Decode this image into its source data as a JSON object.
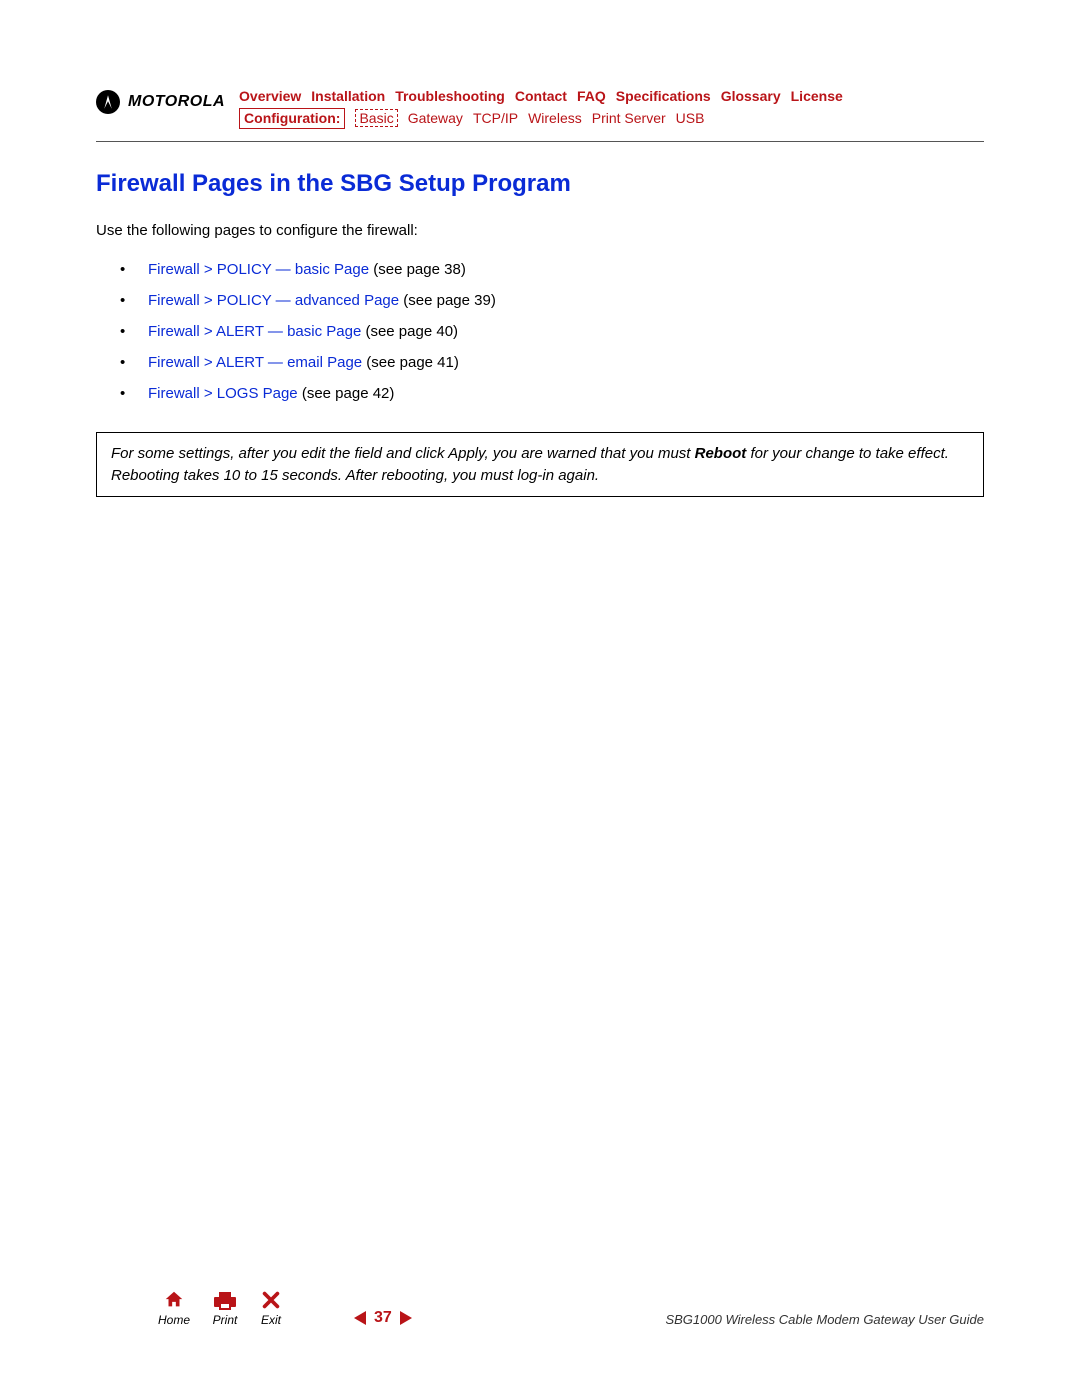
{
  "brand": {
    "word": "MOTOROLA"
  },
  "nav_top": [
    "Overview",
    "Installation",
    "Troubleshooting",
    "Contact",
    "FAQ",
    "Specifications",
    "Glossary",
    "License"
  ],
  "nav_sub": {
    "label": "Configuration:",
    "items": [
      "Basic",
      "Gateway",
      "TCP/IP",
      "Wireless",
      "Print Server",
      "USB"
    ]
  },
  "title": "Firewall Pages in the SBG Setup Program",
  "intro": "Use the following pages to configure the firewall:",
  "links": [
    {
      "text": "Firewall > POLICY — basic Page",
      "ref": " (see page 38)"
    },
    {
      "text": "Firewall > POLICY — advanced Page",
      "ref": " (see page 39)"
    },
    {
      "text": "Firewall > ALERT — basic Page",
      "ref": " (see page 40)"
    },
    {
      "text": "Firewall > ALERT — email Page",
      "ref": " (see page 41)"
    },
    {
      "text": "Firewall > LOGS Page",
      "ref": " (see page 42)"
    }
  ],
  "note": {
    "pre": "For some settings, after you edit the field and click Apply, you are warned that you must ",
    "strong": "Reboot",
    "post": " for your change to take effect. Rebooting takes 10 to 15 seconds. After rebooting, you must log-in again."
  },
  "footer": {
    "icons": {
      "home": "Home",
      "print": "Print",
      "exit": "Exit"
    },
    "page": "37",
    "doc": "SBG1000 Wireless Cable Modem Gateway User Guide"
  }
}
